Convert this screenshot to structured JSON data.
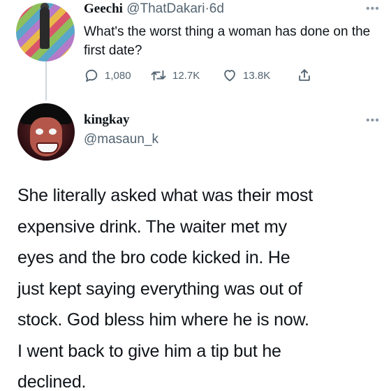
{
  "parent_tweet": {
    "author_name": "Geechi",
    "author_handle": "@ThatDakari",
    "separator": "·",
    "time": "6d",
    "text": "What's the worst thing a woman has done on the first date?",
    "more_icon": "more-horizontal-icon",
    "actions": {
      "reply": {
        "icon": "reply-icon",
        "count": "1,080"
      },
      "retweet": {
        "icon": "retweet-icon",
        "count": "12.7K"
      },
      "like": {
        "icon": "heart-icon",
        "count": "13.8K"
      },
      "share": {
        "icon": "share-icon"
      }
    }
  },
  "reply_tweet": {
    "author_name": "kingkay",
    "author_handle": "@masaun_k",
    "more_icon": "more-horizontal-icon",
    "lines": [
      "She literally asked what was their most",
      "expensive drink. The waiter met my",
      "eyes and the bro code kicked in. He",
      "just kept saying everything was out of",
      "stock. God bless him where he is now.",
      "I went back to give him a tip but he",
      "declined."
    ]
  },
  "colors": {
    "text_primary": "#0f1419",
    "text_secondary": "#536471",
    "thread_line": "#cfd9de",
    "background": "#ffffff"
  }
}
